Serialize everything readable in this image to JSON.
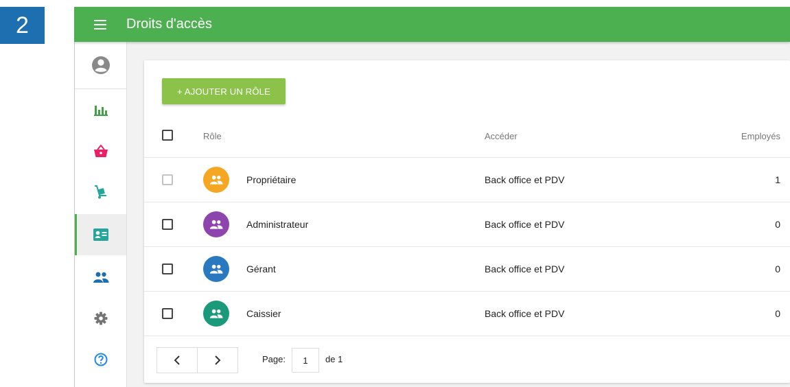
{
  "step_number": "2",
  "header": {
    "title": "Droits d'accès"
  },
  "colors": {
    "topbar": "#4caf50",
    "add_button": "#8bc34a",
    "step_badge": "#1e6fb0",
    "sidebar_active": "#eeeeee"
  },
  "sidebar": {
    "items": [
      {
        "icon": "account-circle-icon",
        "color": "#8a8a8a"
      },
      {
        "icon": "bar-chart-icon",
        "color": "#43a047"
      },
      {
        "icon": "basket-icon",
        "color": "#e91e63"
      },
      {
        "icon": "hand-truck-icon",
        "color": "#26a69a"
      },
      {
        "icon": "badge-icon",
        "color": "#26a69a",
        "active": true
      },
      {
        "icon": "people-icon",
        "color": "#1e6fb0"
      },
      {
        "icon": "gear-icon",
        "color": "#757575"
      },
      {
        "icon": "help-icon",
        "color": "#1e88e5"
      }
    ]
  },
  "toolbar": {
    "add_label": "+ AJOUTER UN RÔLE"
  },
  "table": {
    "columns": {
      "role": "Rôle",
      "access": "Accéder",
      "employees": "Employés"
    },
    "rows": [
      {
        "role": "Propriétaire",
        "access": "Back office et PDV",
        "employees": "1",
        "avatar_color": "#f5a623",
        "checkbox_disabled": true
      },
      {
        "role": "Administrateur",
        "access": "Back office et PDV",
        "employees": "0",
        "avatar_color": "#8e44ad",
        "checkbox_disabled": false
      },
      {
        "role": "Gérant",
        "access": "Back office et PDV",
        "employees": "0",
        "avatar_color": "#2979c0",
        "checkbox_disabled": false
      },
      {
        "role": "Caissier",
        "access": "Back office et PDV",
        "employees": "0",
        "avatar_color": "#1a9a7a",
        "checkbox_disabled": false
      }
    ]
  },
  "pagination": {
    "page_label": "Page:",
    "current_page": "1",
    "of_label": "de 1"
  }
}
